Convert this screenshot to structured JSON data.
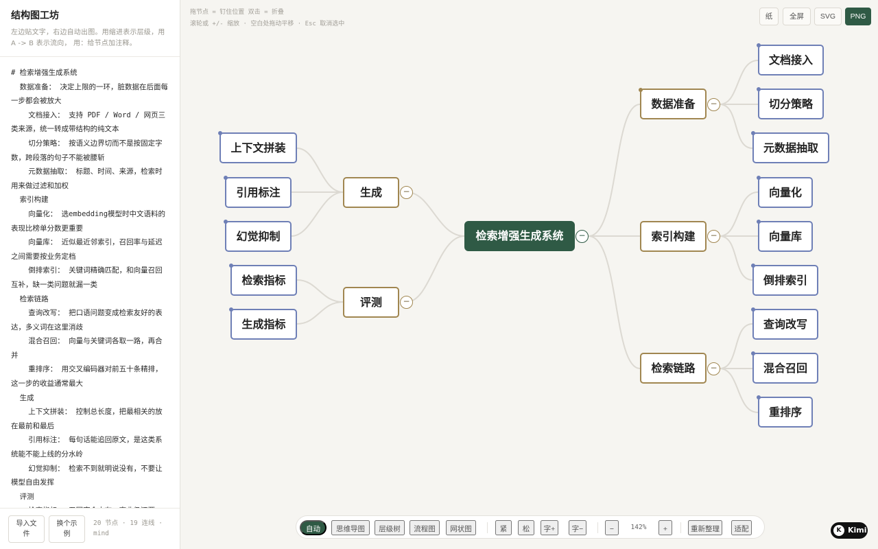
{
  "sidebar": {
    "title": "结构图工坊",
    "description": "左边贴文字，右边自动出图。用缩进表示层级，用 A -> B 表示流向， 用：给节点加注释。",
    "editor_text": "# 检索增强生成系统\n  数据准备： 决定上限的一环，脏数据在后面每一步都会被放大\n    文档接入： 支持 PDF / Word / 网页三类来源，统一转成带结构的纯文本\n    切分策略： 按语义边界切而不是按固定字数，跨段落的句子不能被腰斩\n    元数据抽取： 标题、时间、来源，检索时用来做过滤和加权\n  索引构建\n    向量化： 选embedding模型时中文语料的表现比榜单分数更重要\n    向量库： 近似最近邻索引，召回率与延迟之间需要按业务定档\n    倒排索引： 关键词精确匹配，和向量召回互补，缺一类问题就漏一类\n  检索链路\n    查询改写： 把口语问题变成检索友好的表达，多义词在这里消歧\n    混合召回： 向量与关键词各取一路，再合并\n    重排序： 用交叉编码器对前五十条精排，这一步的收益通常最大\n  生成\n    上下文拼装： 控制总长度，把最相关的放在最前和最后\n    引用标注： 每句话能追回原文，是这类系统能不能上线的分水岭\n    幻觉抑制： 检索不到就明说没有，不要让模型自由发挥\n  评测\n    检索指标： 召回率会十有一事业仍还要",
    "footer": {
      "import_label": "导入文件",
      "example_label": "换个示例",
      "stats": "20 节点 · 19 连线 · mind"
    }
  },
  "hints": {
    "line1": "拖节点 = 钉住位置  双击 = 折叠",
    "line2": "滚轮或 +/- 缩放 · 空白处拖动平移 · Esc 取消选中"
  },
  "top_actions": {
    "paper": "纸",
    "fullscreen": "全屏",
    "svg": "SVG",
    "png": "PNG"
  },
  "mindmap": {
    "root": "检索增强生成系统",
    "branches": {
      "data_prep": "数据准备",
      "indexing": "索引构建",
      "retrieval": "检索链路",
      "generation": "生成",
      "evaluation": "评测"
    },
    "leaves": {
      "doc_ingest": "文档接入",
      "chunking": "切分策略",
      "metadata": "元数据抽取",
      "vectorize": "向量化",
      "vector_db": "向量库",
      "inverted": "倒排索引",
      "rewrite": "查询改写",
      "hybrid": "混合召回",
      "rerank": "重排序",
      "context": "上下文拼装",
      "citation": "引用标注",
      "halluc": "幻觉抑制",
      "ret_metric": "检索指标",
      "gen_metric": "生成指标"
    },
    "collapse_symbol": "−"
  },
  "toolbar": {
    "auto": "自动",
    "mindmap": "思维导图",
    "tree": "层级树",
    "flow": "流程图",
    "network": "网状图",
    "tight": "紧",
    "loose": "松",
    "font_up": "字+",
    "font_down": "字−",
    "zoom_out": "−",
    "zoom": "142%",
    "zoom_in": "+",
    "relayout": "重新整理",
    "fit": "适配"
  },
  "brand": "Kimi",
  "colors": {
    "accent": "#2f5a45",
    "branch_border": "#a08650",
    "leaf_border": "#6e7fb6"
  }
}
